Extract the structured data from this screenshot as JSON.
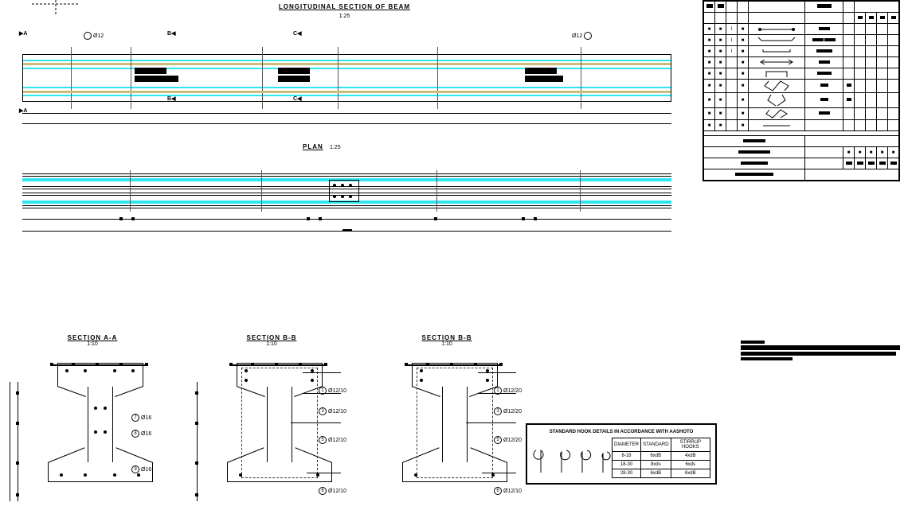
{
  "titles": {
    "long": "LONGITUDINAL SECTION OF BEAM",
    "long_scale": "1:25",
    "plan": "PLAN",
    "plan_scale": "1:25",
    "aa": "SECTION A-A",
    "aa_scale": "1:10",
    "bb": "SECTION B-B",
    "bb_scale": "1:10",
    "bb2": "SECTION B-B",
    "bb2_scale": "1:10"
  },
  "section_cuts": {
    "A": "A",
    "B": "B",
    "C": "C"
  },
  "rebar_callouts": {
    "long_1": "Ø12",
    "long_2": "Ø12",
    "aa": [
      {
        "n": "7",
        "s": "Ø16"
      },
      {
        "n": "8",
        "s": "Ø16"
      },
      {
        "n": "9",
        "s": "Ø16"
      }
    ],
    "bb": [
      {
        "n": "1",
        "s": "Ø12/10"
      },
      {
        "n": "3",
        "s": "Ø12/10"
      },
      {
        "n": "5",
        "s": "Ø12/10"
      },
      {
        "n": "6",
        "s": "Ø12/10"
      }
    ],
    "bb2": [
      {
        "n": "1",
        "s": "Ø12/20"
      },
      {
        "n": "3",
        "s": "Ø12/20"
      },
      {
        "n": "5",
        "s": "Ø12/20"
      },
      {
        "n": "6",
        "s": "Ø12/10"
      }
    ]
  },
  "hook_table": {
    "title": "STANDARD HOOK DETAILS IN ACCORDANCE WITH AASHOTO",
    "headers": [
      "DIAMETER",
      "STANDARD",
      "STIRRUP HOOKS"
    ],
    "rows": [
      [
        "8-18",
        "6xdB",
        "4xdB"
      ],
      [
        "18-30",
        "8xds",
        "6xds"
      ],
      [
        "28-30",
        "6xdB",
        "6xdB"
      ]
    ]
  },
  "schedule": {
    "col_count_top": 8,
    "col_count_bottom": 6,
    "rows": 11
  }
}
